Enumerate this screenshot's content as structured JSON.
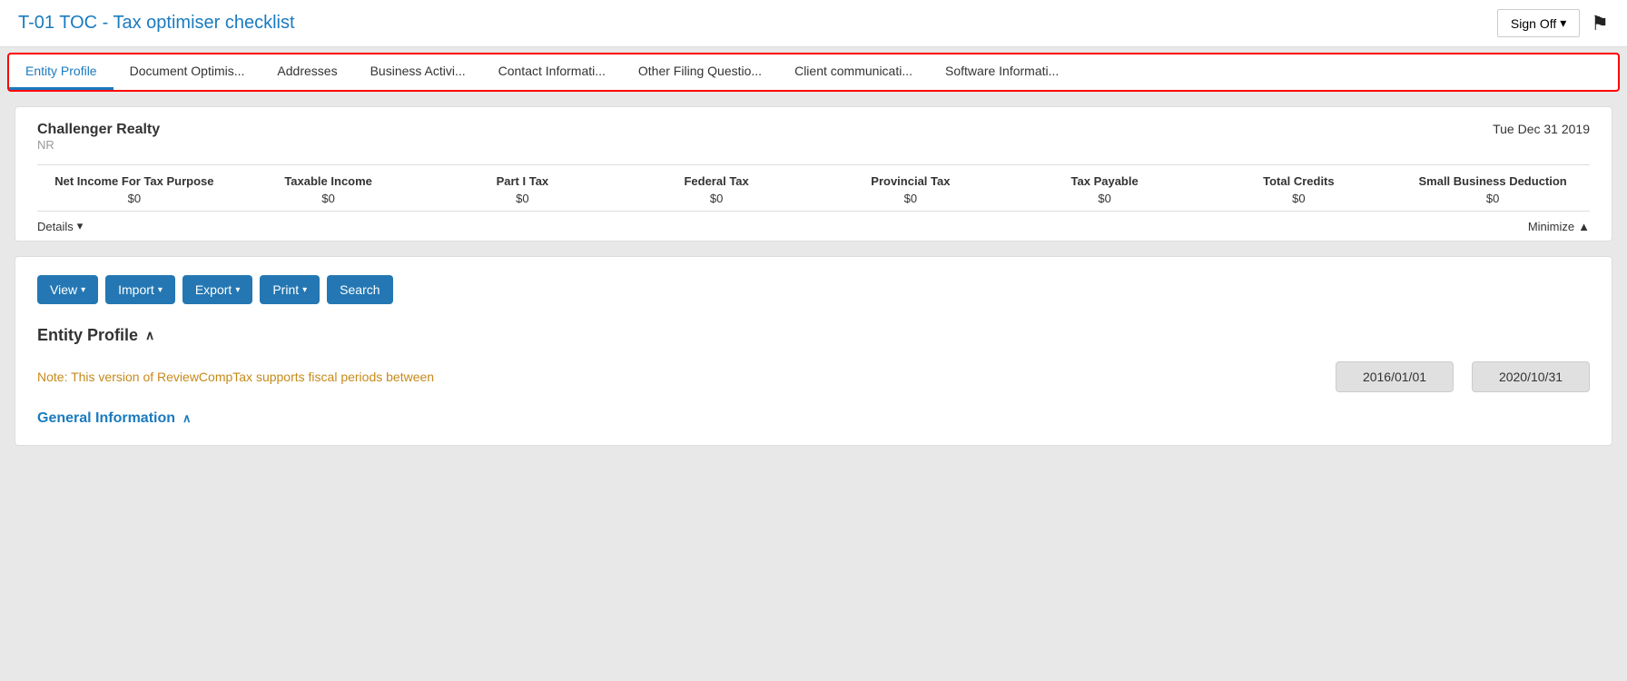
{
  "app": {
    "title": "T-01 TOC - Tax optimiser checklist"
  },
  "header": {
    "sign_off_label": "Sign Off",
    "caret": "▾"
  },
  "tabs": [
    {
      "id": "entity-profile",
      "label": "Entity Profile",
      "active": true
    },
    {
      "id": "document-optimis",
      "label": "Document Optimis...",
      "active": false
    },
    {
      "id": "addresses",
      "label": "Addresses",
      "active": false
    },
    {
      "id": "business-activi",
      "label": "Business Activi...",
      "active": false
    },
    {
      "id": "contact-informati",
      "label": "Contact Informati...",
      "active": false
    },
    {
      "id": "other-filing-questio",
      "label": "Other Filing Questio...",
      "active": false
    },
    {
      "id": "client-communicati",
      "label": "Client communicati...",
      "active": false
    },
    {
      "id": "software-informati",
      "label": "Software Informati...",
      "active": false
    }
  ],
  "summary": {
    "company_name": "Challenger Realty",
    "company_subtitle": "NR",
    "date": "Tue Dec 31 2019",
    "columns": [
      {
        "label": "Net Income For Tax Purpose",
        "value": "$0"
      },
      {
        "label": "Taxable Income",
        "value": "$0"
      },
      {
        "label": "Part I Tax",
        "value": "$0"
      },
      {
        "label": "Federal Tax",
        "value": "$0"
      },
      {
        "label": "Provincial Tax",
        "value": "$0"
      },
      {
        "label": "Tax Payable",
        "value": "$0"
      },
      {
        "label": "Total Credits",
        "value": "$0"
      },
      {
        "label": "Small Business Deduction",
        "value": "$0"
      }
    ],
    "details_label": "Details",
    "minimize_label": "Minimize",
    "details_caret": "▾",
    "minimize_caret": "▲"
  },
  "toolbar": {
    "buttons": [
      {
        "id": "view",
        "label": "View",
        "has_caret": true
      },
      {
        "id": "import",
        "label": "Import",
        "has_caret": true
      },
      {
        "id": "export",
        "label": "Export",
        "has_caret": true
      },
      {
        "id": "print",
        "label": "Print",
        "has_caret": true
      },
      {
        "id": "search",
        "label": "Search",
        "has_caret": false
      }
    ]
  },
  "entity_profile": {
    "section_title": "Entity Profile",
    "chevron": "∧",
    "note_text": "Note: This version of ReviewCompTax supports fiscal periods between",
    "date_from": "2016/01/01",
    "date_to": "2020/10/31"
  },
  "general_info": {
    "section_title": "General Information",
    "chevron": "∧"
  }
}
